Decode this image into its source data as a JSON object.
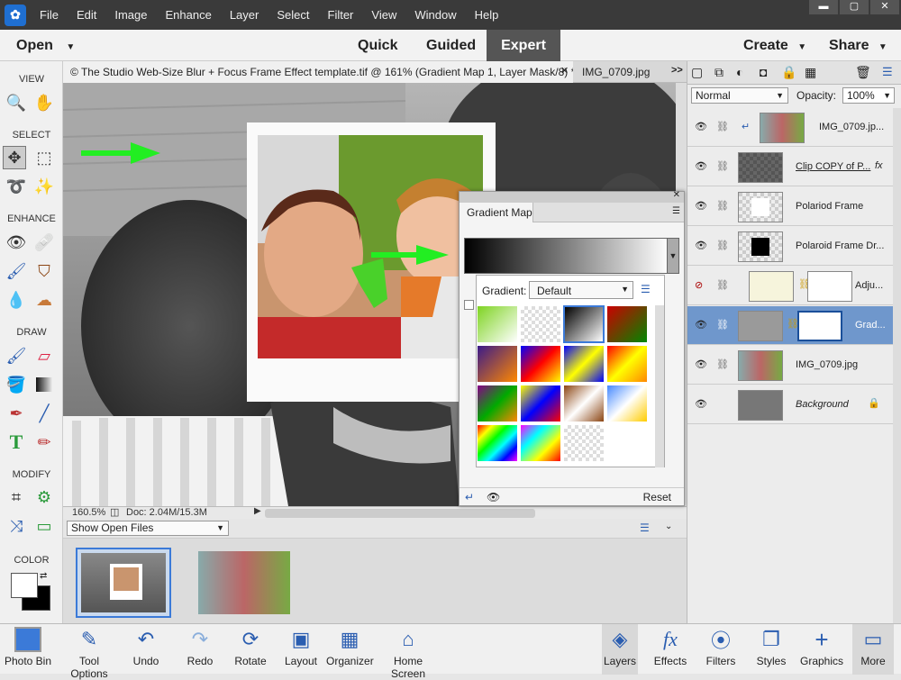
{
  "menu": {
    "items": [
      "File",
      "Edit",
      "Image",
      "Enhance",
      "Layer",
      "Select",
      "Filter",
      "View",
      "Window",
      "Help"
    ]
  },
  "modebar": {
    "open": "Open",
    "quick": "Quick",
    "guided": "Guided",
    "expert": "Expert",
    "create": "Create",
    "share": "Share"
  },
  "tools": {
    "view": "VIEW",
    "select": "SELECT",
    "enhance": "ENHANCE",
    "draw": "DRAW",
    "modify": "MODIFY",
    "color": "COLOR"
  },
  "doctabs": {
    "tab1": "© The Studio Web-Size Blur + Focus Frame Effect template.tif @ 161% (Gradient Map 1, Layer Mask/8) *",
    "tab2": "IMG_0709.jpg",
    "more": ">>"
  },
  "status": {
    "zoom": "160.5%",
    "doc": "Doc: 2.04M/15.3M"
  },
  "bin": {
    "show": "Show Open Files"
  },
  "layers_panel": {
    "blend": "Normal",
    "opacity_label": "Opacity:",
    "opacity": "100%",
    "layers": [
      {
        "name": "IMG_0709.jp..."
      },
      {
        "name": "Clip COPY of P...",
        "fx": "fx"
      },
      {
        "name": "Polariod Frame"
      },
      {
        "name": "Polaroid Frame Dr..."
      },
      {
        "name": "Adju..."
      },
      {
        "name": "Grad..."
      },
      {
        "name": "IMG_0709.jpg"
      },
      {
        "name": "Background"
      }
    ]
  },
  "gradient_map": {
    "tab": "Gradient Map",
    "gradient_label": "Gradient:",
    "gradient_value": "Default",
    "reset": "Reset"
  },
  "bottom": {
    "photo_bin": "Photo Bin",
    "tool_options": "Tool Options",
    "undo": "Undo",
    "redo": "Redo",
    "rotate": "Rotate",
    "layout": "Layout",
    "organizer": "Organizer",
    "home": "Home Screen",
    "layers": "Layers",
    "effects": "Effects",
    "filters": "Filters",
    "styles": "Styles",
    "graphics": "Graphics",
    "more": "More"
  },
  "colors": {
    "accent": "#6f97cc",
    "arrow": "#22ee22"
  }
}
